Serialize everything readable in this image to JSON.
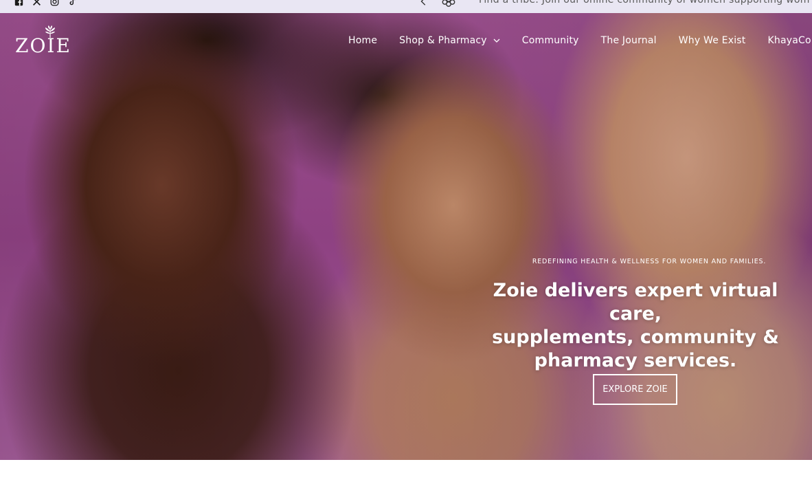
{
  "announcement": {
    "text": "Find a tribe. Join our online community of women supporting wom",
    "prev_icon": "chevron-left-icon",
    "logo_icon": "zoie-flower-icon"
  },
  "social": [
    {
      "name": "facebook-icon"
    },
    {
      "name": "x-icon"
    },
    {
      "name": "instagram-icon"
    },
    {
      "name": "tiktok-icon"
    }
  ],
  "header": {
    "logo_text": "ZOIE",
    "nav": [
      {
        "label": "Home"
      },
      {
        "label": "Shop & Pharmacy",
        "has_dropdown": true
      },
      {
        "label": "Community"
      },
      {
        "label": "The Journal"
      },
      {
        "label": "Why We Exist"
      },
      {
        "label": "KhayaCo"
      }
    ]
  },
  "hero": {
    "eyebrow": "REDEFINING HEALTH & WELLNESS FOR WOMEN AND FAMILIES.",
    "headline_line1": "Zoie delivers expert virtual care,",
    "headline_line2": "supplements, community &",
    "headline_line3": "pharmacy services.",
    "cta_label": "EXPLORE ZOIE"
  },
  "colors": {
    "topbar_bg": "#e9e6f3",
    "hero_bg": "#8e4182",
    "text_on_hero": "#ffffff"
  }
}
